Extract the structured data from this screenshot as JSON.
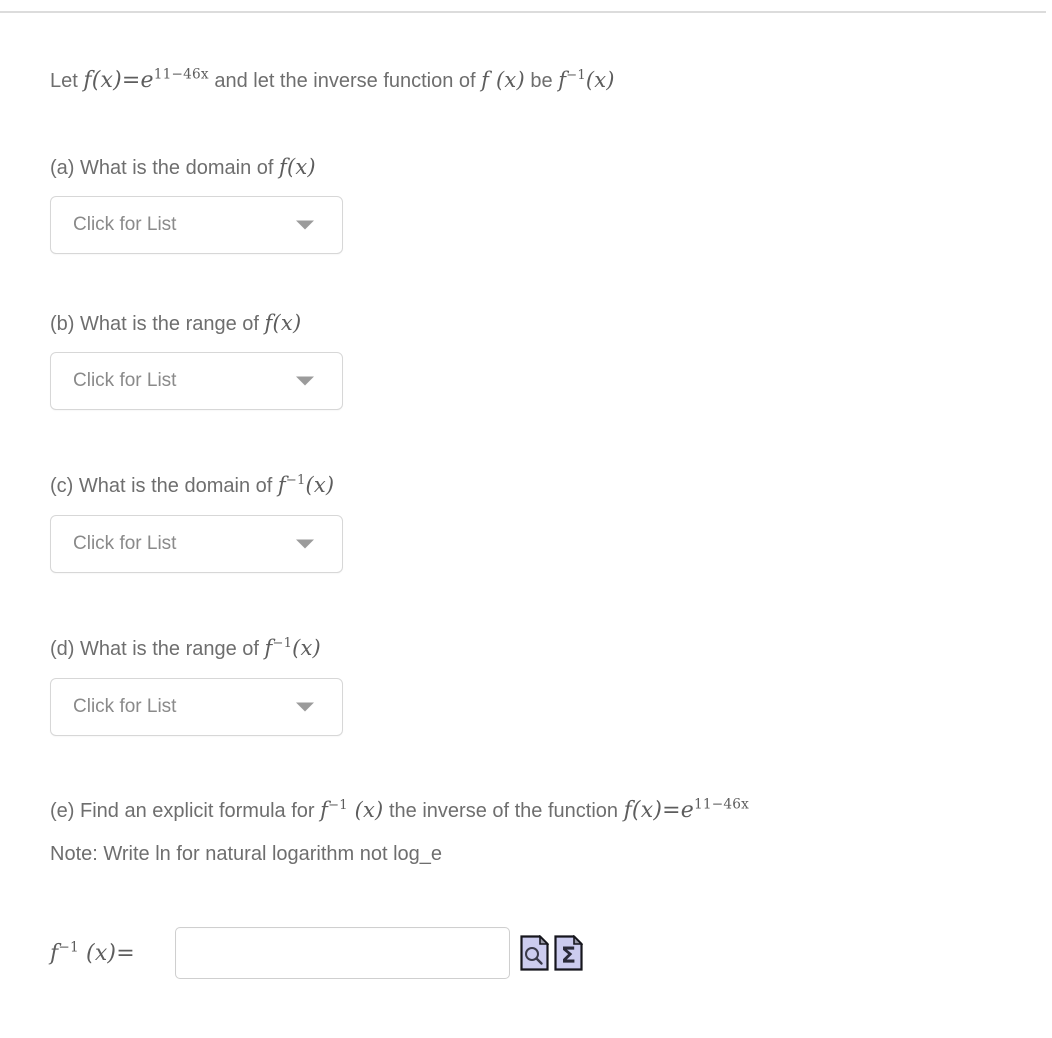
{
  "problem": {
    "intro": {
      "lead": "Let",
      "f_of_x": "f(x)",
      "equals": "=",
      "base": "e",
      "exponent": "11−46x",
      "middle": "and let the inverse function of",
      "f_paren_x": "f (x)",
      "be": "be",
      "f_inverse": "f",
      "inverse_power": "−1",
      "inverse_arg": "(x)"
    },
    "parts": [
      {
        "id": "a",
        "label": "(a) What is the domain of",
        "math_base": "f",
        "math_sup": "",
        "math_arg": "(x)",
        "dropdown": {
          "name": "domain-of-f-dropdown",
          "value": "Click for List",
          "arrow_icon": "chevron-down-icon"
        }
      },
      {
        "id": "b",
        "label": "(b) What is the range of",
        "math_base": "f",
        "math_sup": "",
        "math_arg": "(x)",
        "dropdown": {
          "name": "range-of-f-dropdown",
          "value": "Click for List",
          "arrow_icon": "chevron-down-icon"
        }
      },
      {
        "id": "c",
        "label": "(c) What is the domain of",
        "math_base": "f",
        "math_sup": "−1",
        "math_arg": "(x)",
        "dropdown": {
          "name": "domain-of-f-inverse-dropdown",
          "value": "Click for List",
          "arrow_icon": "chevron-down-icon"
        }
      },
      {
        "id": "d",
        "label": "(d) What is the range of",
        "math_base": "f",
        "math_sup": "−1",
        "math_arg": "(x)",
        "dropdown": {
          "name": "range-of-f-inverse-dropdown",
          "value": "Click for List",
          "arrow_icon": "chevron-down-icon"
        }
      }
    ],
    "part_e": {
      "text_1": "(e) Find an explicit formula for",
      "f_inverse_base": "f",
      "f_inverse_sup": "−1",
      "f_inverse_arg": "(x)",
      "text_2": "the inverse of the function",
      "f_of_x": "f(x)",
      "equals": "=",
      "base": "e",
      "exponent": "11−46x",
      "note": "Note: Write ln for natural logarithm not log_e"
    },
    "answer": {
      "label_base": "f",
      "label_sup": "−1",
      "label_arg": "(x)",
      "label_equals": "=",
      "input_value": "",
      "input_placeholder": "",
      "preview_icon": "preview-magnifier-icon",
      "mathpad_icon": "math-sigma-icon"
    }
  },
  "colors": {
    "text": "#6e6e6e",
    "math": "#5d5d5d",
    "placeholder": "#8a8a8a",
    "border": "#d7d7d7",
    "divider": "#dcdcdc",
    "icon_fill": "#ccccef",
    "icon_stroke": "#16161d"
  }
}
